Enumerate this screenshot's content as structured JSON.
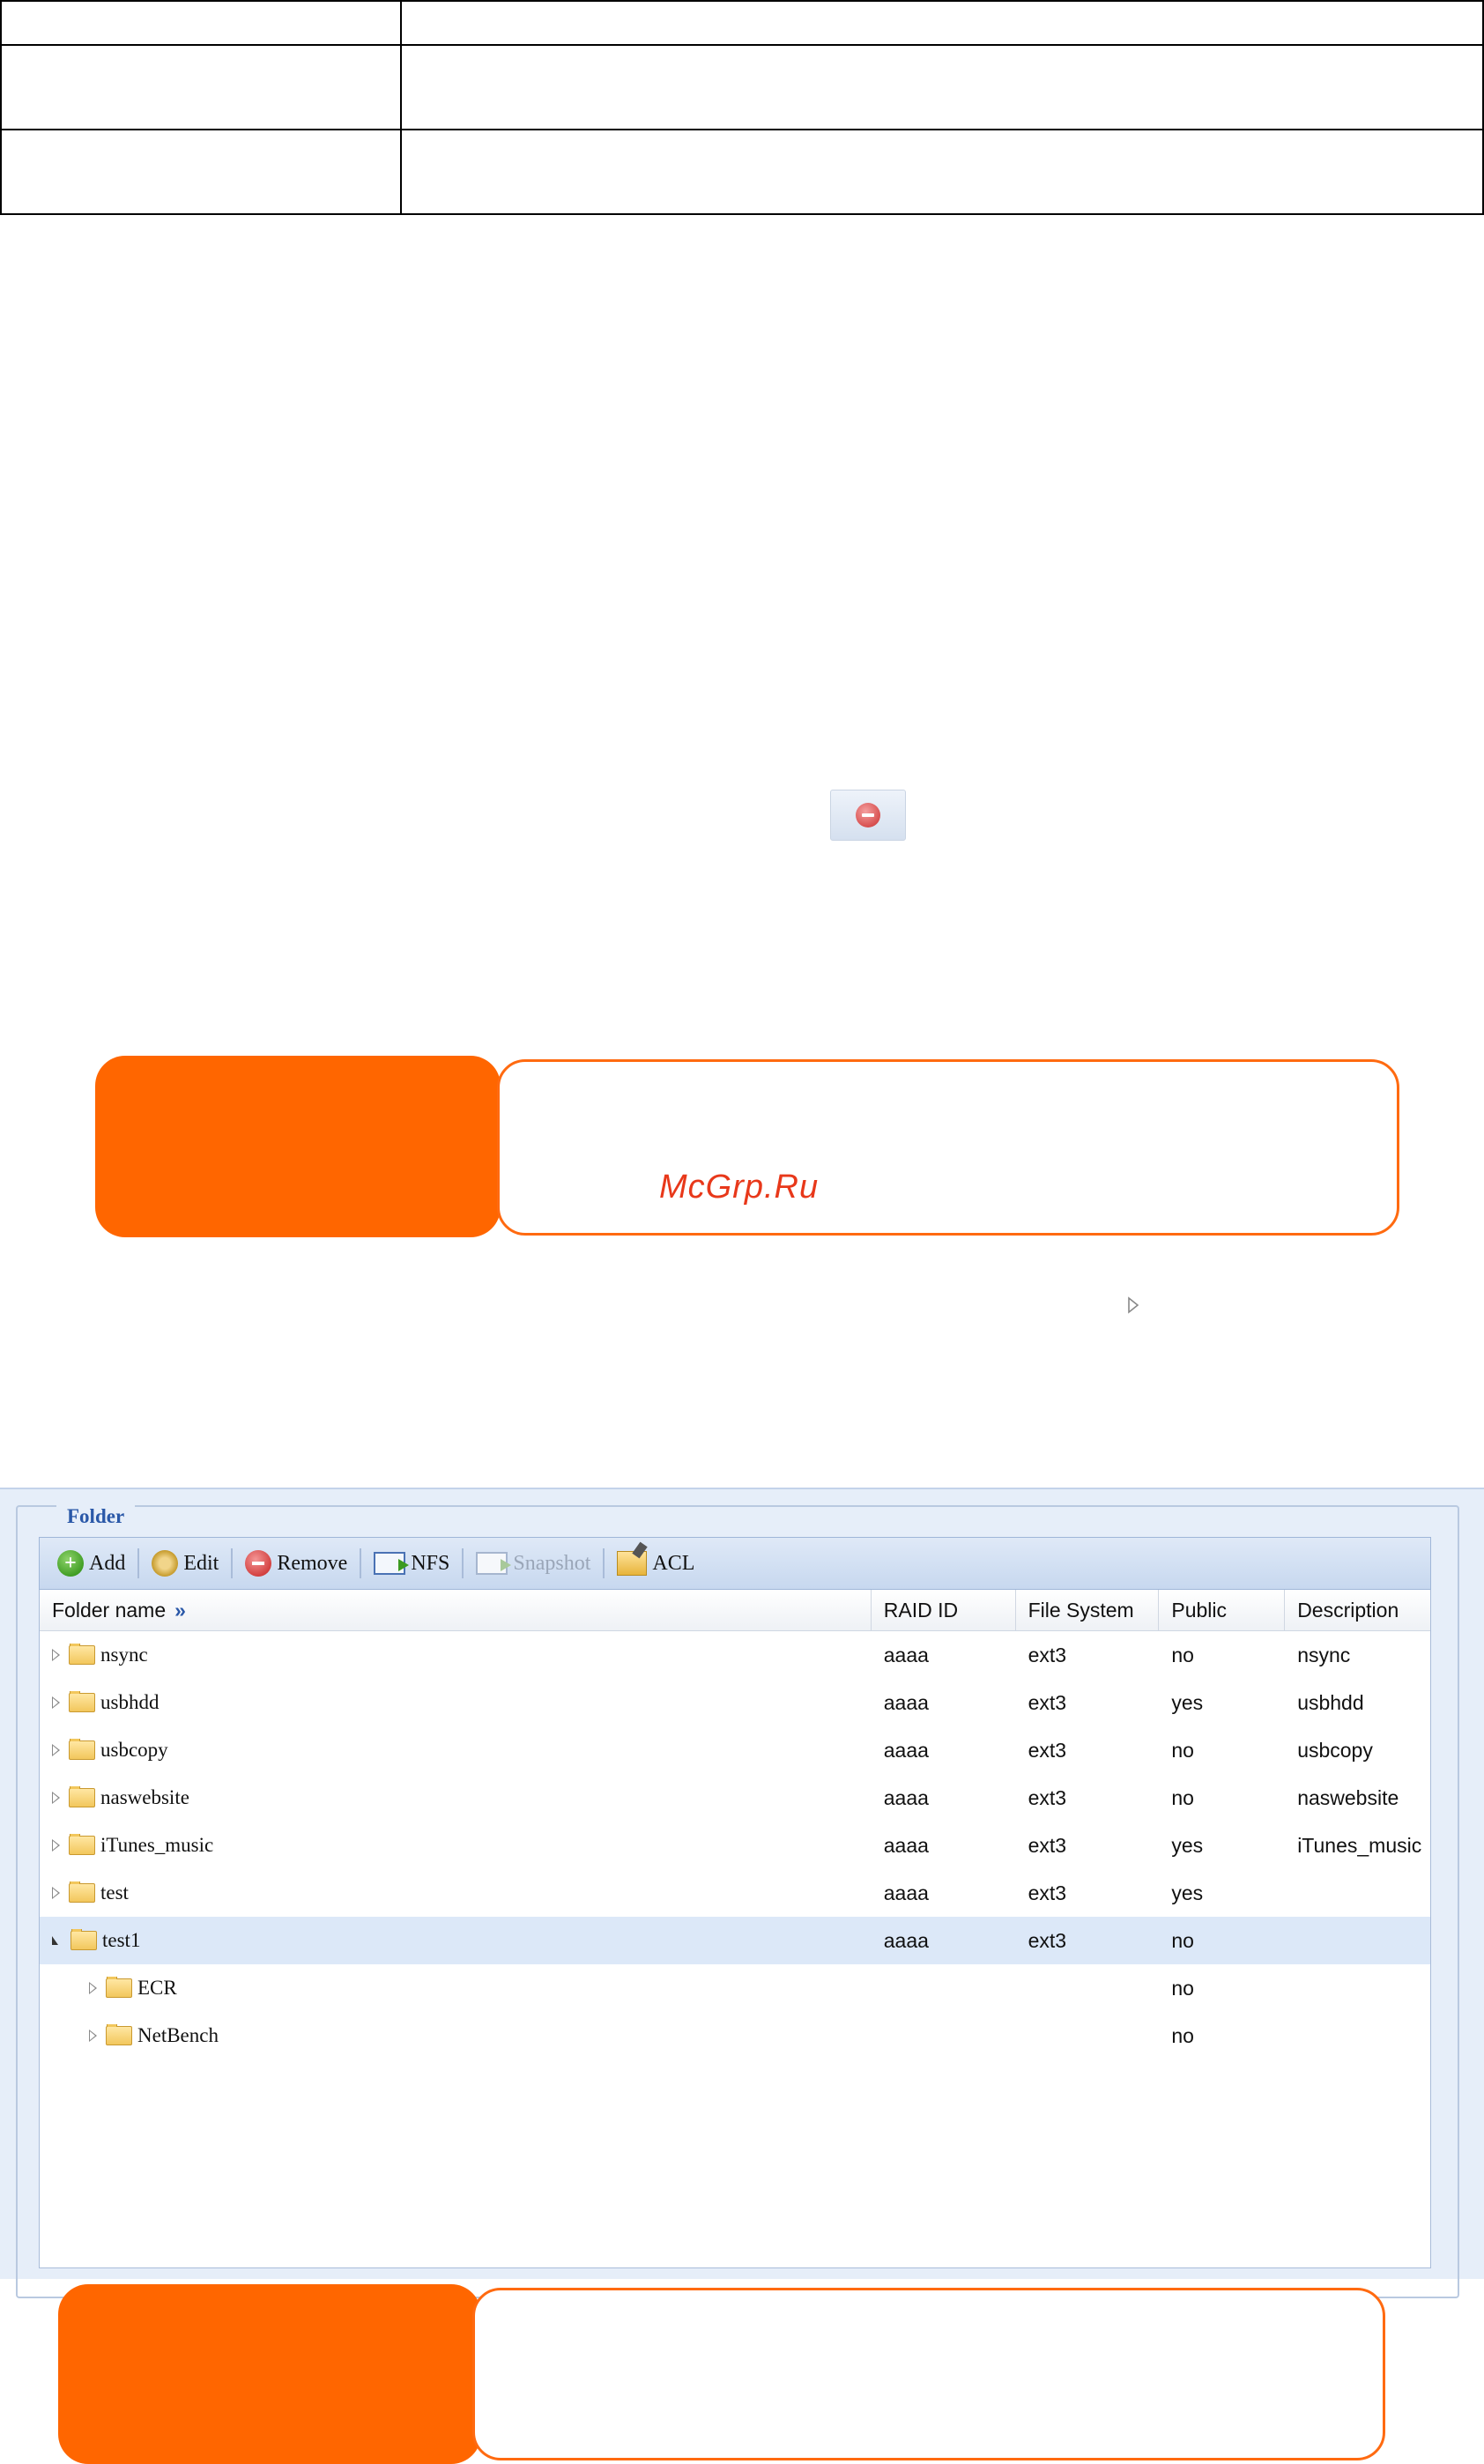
{
  "watermark": "McGrp.Ru",
  "folder_panel": {
    "legend": "Folder",
    "toolbar": {
      "add": "Add",
      "edit": "Edit",
      "remove": "Remove",
      "nfs": "NFS",
      "snapshot": "Snapshot",
      "acl": "ACL"
    },
    "columns": {
      "folder_name": "Folder name",
      "folder_name_chevron": "»",
      "raid_id": "RAID ID",
      "file_system": "File System",
      "public": "Public",
      "description": "Description"
    },
    "rows": [
      {
        "name": "nsync",
        "raid": "aaaa",
        "fs": "ext3",
        "public": "no",
        "desc": "nsync"
      },
      {
        "name": "usbhdd",
        "raid": "aaaa",
        "fs": "ext3",
        "public": "yes",
        "desc": "usbhdd"
      },
      {
        "name": "usbcopy",
        "raid": "aaaa",
        "fs": "ext3",
        "public": "no",
        "desc": "usbcopy"
      },
      {
        "name": "naswebsite",
        "raid": "aaaa",
        "fs": "ext3",
        "public": "no",
        "desc": "naswebsite"
      },
      {
        "name": "iTunes_music",
        "raid": "aaaa",
        "fs": "ext3",
        "public": "yes",
        "desc": "iTunes_music"
      },
      {
        "name": "test",
        "raid": "aaaa",
        "fs": "ext3",
        "public": "yes",
        "desc": ""
      },
      {
        "name": "test1",
        "raid": "aaaa",
        "fs": "ext3",
        "public": "no",
        "desc": ""
      },
      {
        "name": "ECR",
        "raid": "",
        "fs": "",
        "public": "no",
        "desc": ""
      },
      {
        "name": "NetBench",
        "raid": "",
        "fs": "",
        "public": "no",
        "desc": ""
      }
    ]
  },
  "icons": {
    "remove_icon": "remove-icon",
    "expand_arrow": "expand-arrow-icon"
  },
  "colors": {
    "note_orange": "#ff6600",
    "selected_row": "#dce8f8",
    "legend_blue": "#2a58a8"
  }
}
